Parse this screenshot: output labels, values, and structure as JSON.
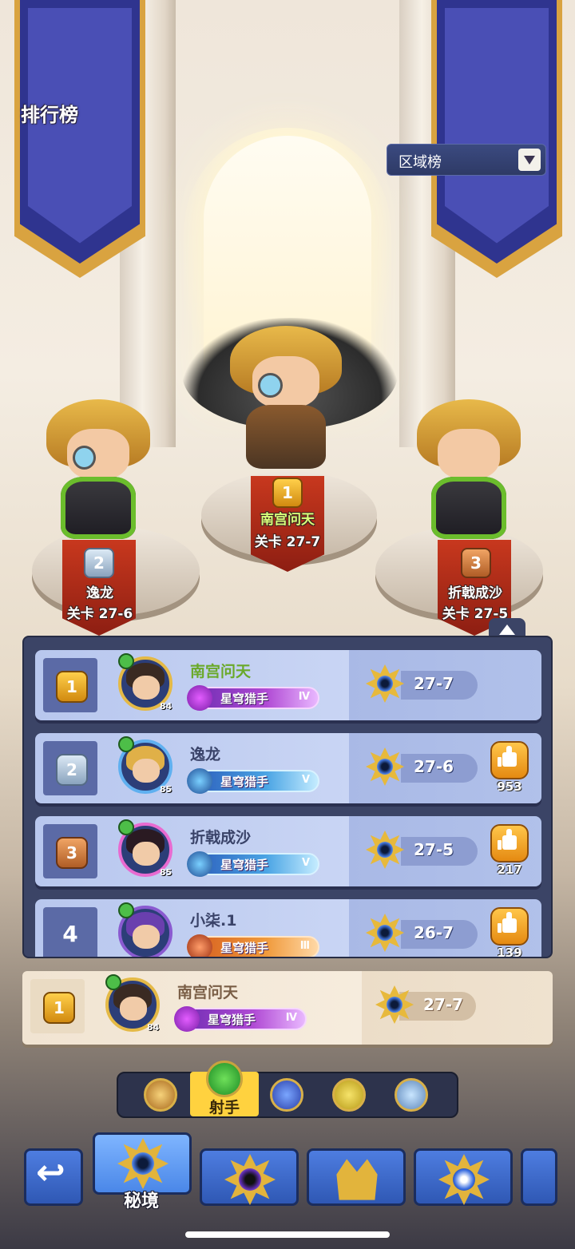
{
  "header": {
    "title": "排行榜",
    "region_dropdown": {
      "selected": "区域榜"
    }
  },
  "podium": [
    {
      "rank": "1",
      "name": "南宫问天",
      "stage": "关卡 27-7"
    },
    {
      "rank": "2",
      "name": "逸龙",
      "stage": "关卡 27-6"
    },
    {
      "rank": "3",
      "name": "折戟成沙",
      "stage": "关卡 27-5"
    }
  ],
  "leaderboard": {
    "rows": [
      {
        "rank": "1",
        "name": "南宫问天",
        "level": "84",
        "title": "星穹猎手",
        "title_tier": "Ⅳ",
        "stage": "27-7",
        "likes": ""
      },
      {
        "rank": "2",
        "name": "逸龙",
        "level": "85",
        "title": "星穹猎手",
        "title_tier": "Ⅴ",
        "stage": "27-6",
        "likes": "953"
      },
      {
        "rank": "3",
        "name": "折戟成沙",
        "level": "85",
        "title": "星穹猎手",
        "title_tier": "Ⅴ",
        "stage": "27-5",
        "likes": "217"
      },
      {
        "rank": "4",
        "name": "小柒.1",
        "level": "",
        "title": "星穹猎手",
        "title_tier": "Ⅲ",
        "stage": "26-7",
        "likes": "139"
      }
    ]
  },
  "my_entry": {
    "rank": "1",
    "name": "南宫问天",
    "level": "84",
    "title": "星穹猎手",
    "title_tier": "Ⅳ",
    "stage": "27-7"
  },
  "class_filter": {
    "items": [
      "axe-class-icon",
      "bow-class-icon",
      "staff-class-icon",
      "sword-class-icon",
      "holy-class-icon"
    ],
    "selected_label": "射手"
  },
  "bottom_nav": {
    "items": [
      "back-icon",
      "secret-realm-icon",
      "purple-eye-emblem-icon",
      "crown-emblem-icon",
      "blue-star-emblem-icon"
    ],
    "active_label": "秘境"
  },
  "colors": {
    "gold": "#e7b93c",
    "panel": "#3b4466",
    "row": "#c9d5f4",
    "my_row": "#f6ecdd"
  }
}
